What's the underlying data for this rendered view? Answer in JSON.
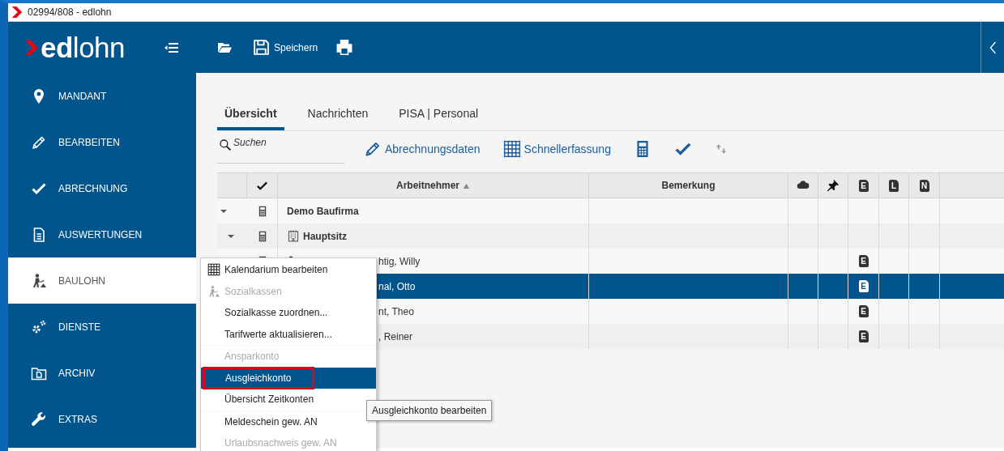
{
  "window": {
    "title": "02994/808 - edlohn"
  },
  "header": {
    "logo": "**ed**lohn",
    "save_label": "Speichern"
  },
  "sidebar": {
    "items": [
      {
        "label": "MANDANT",
        "selected": false
      },
      {
        "label": "BEARBEITEN",
        "selected": false
      },
      {
        "label": "ABRECHNUNG",
        "selected": false
      },
      {
        "label": "AUSWERTUNGEN",
        "selected": false
      },
      {
        "label": "BAULOHN",
        "selected": true
      },
      {
        "label": "DIENSTE",
        "selected": false
      },
      {
        "label": "ARCHIV",
        "selected": false
      },
      {
        "label": "EXTRAS",
        "selected": false
      }
    ]
  },
  "tabs": [
    {
      "label": "Übersicht",
      "selected": true
    },
    {
      "label": "Nachrichten",
      "selected": false
    },
    {
      "label": "PISA | Personal",
      "selected": false
    }
  ],
  "search": {
    "placeholder": "Suchen"
  },
  "toolbar": [
    {
      "kind": "pencil",
      "label": "Abrechnungsdaten",
      "disabled": false
    },
    {
      "kind": "grid",
      "label": "Schnellerfassung",
      "disabled": false
    },
    {
      "kind": "calculator",
      "disabled": false
    },
    {
      "kind": "check",
      "disabled": false
    },
    {
      "kind": "sync",
      "disabled": true
    }
  ],
  "table": {
    "columns": [
      {
        "kind": "blank"
      },
      {
        "kind": "check"
      },
      {
        "kind": "text",
        "label": "Arbeitnehmer",
        "sorted": true
      },
      {
        "kind": "text",
        "label": "Bemerkung",
        "sorted": false
      },
      {
        "kind": "cloud"
      },
      {
        "kind": "pin"
      },
      {
        "kind": "doc",
        "letter": "E"
      },
      {
        "kind": "doc",
        "letter": "L"
      },
      {
        "kind": "doc",
        "letter": "N"
      }
    ],
    "rows": [
      {
        "kind": "company",
        "label": "Demo Baufirma",
        "expanded": true,
        "selected": false,
        "children": [
          {
            "kind": "branch",
            "label": "Hauptsitz",
            "expanded": true,
            "selected": false,
            "children": [
              {
                "kind": "employee",
                "label": "htig, Willy",
                "calculator": true,
                "person": true,
                "doc": "E",
                "selected": false
              },
              {
                "kind": "employee",
                "label": "nal, Otto",
                "doc": "E",
                "selected": true
              },
              {
                "kind": "employee",
                "label": "nt, Theo",
                "doc": "E",
                "selected": false
              },
              {
                "kind": "employee",
                "label": ", Reiner",
                "doc": "E",
                "selected": false
              }
            ]
          }
        ]
      }
    ]
  },
  "context_menu": {
    "groups": [
      [
        {
          "label": "Kalendarium bearbeiten",
          "kind": "grid",
          "disabled": false,
          "selected": false,
          "annotated": false
        },
        {
          "label": "Sozialkassen",
          "kind": "worker",
          "disabled": true,
          "selected": false,
          "annotated": false
        },
        {
          "label": "Sozialkasse zuordnen...",
          "disabled": false,
          "selected": false,
          "annotated": false
        },
        {
          "label": "Tarifwerte aktualisieren...",
          "disabled": false,
          "selected": false,
          "annotated": false
        }
      ],
      [
        {
          "label": "Ansparkonto",
          "disabled": true,
          "selected": false,
          "annotated": false
        },
        {
          "label": "Ausgleichkonto",
          "disabled": false,
          "selected": true,
          "annotated": true
        },
        {
          "label": "Übersicht Zeitkonten",
          "disabled": false,
          "selected": false,
          "annotated": false
        }
      ],
      [
        {
          "label": "Meldeschein gew. AN",
          "disabled": false,
          "selected": false,
          "annotated": false
        },
        {
          "label": "Urlaubsnachweis gew. AN",
          "disabled": true,
          "selected": false,
          "annotated": false
        }
      ]
    ]
  },
  "tooltip": {
    "text": "Ausgleichkonto bearbeiten"
  }
}
